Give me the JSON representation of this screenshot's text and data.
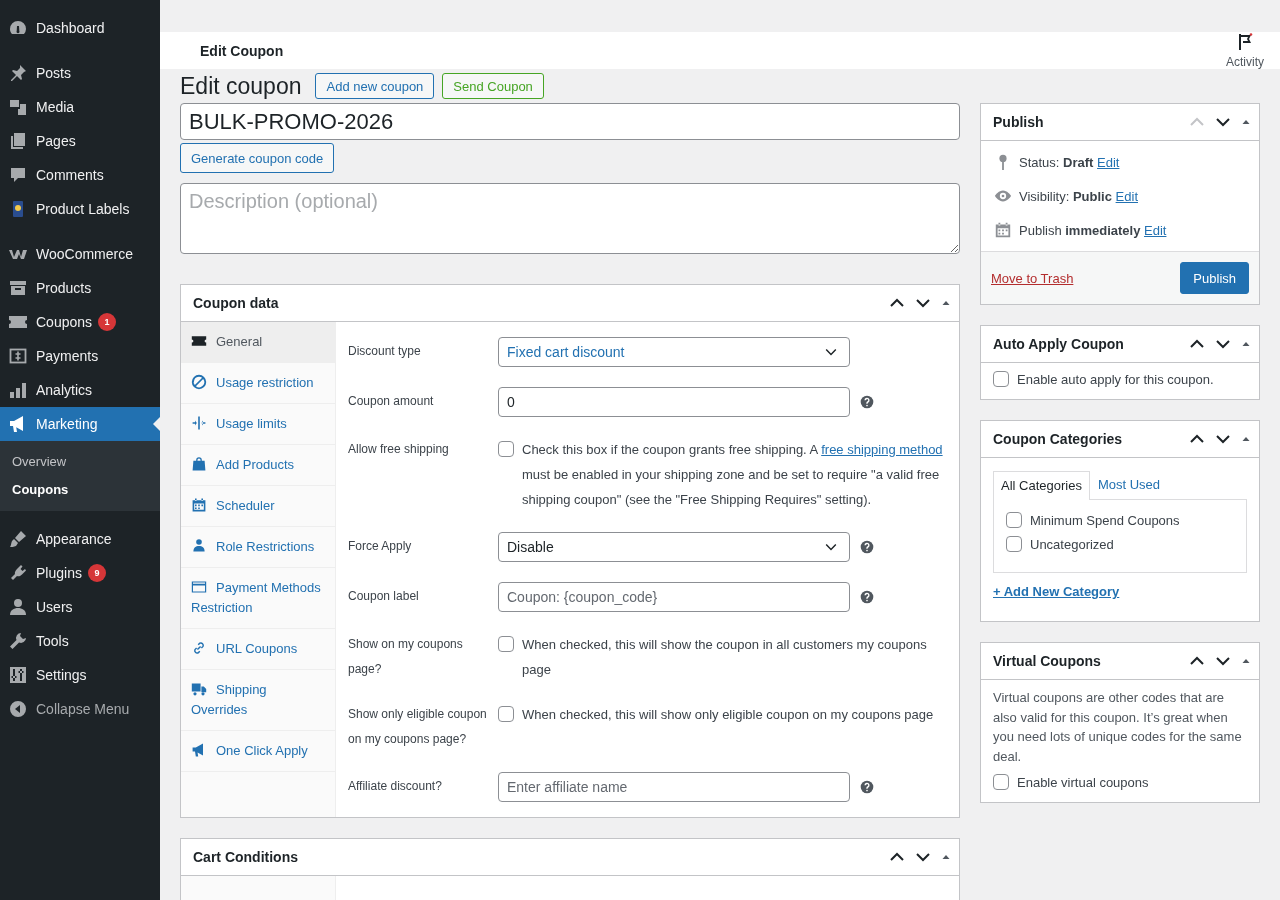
{
  "sidebar": {
    "groups": [
      {
        "items": [
          {
            "label": "Dashboard",
            "selected": false
          }
        ]
      },
      {
        "items": [
          {
            "label": "Posts",
            "selected": false
          },
          {
            "label": "Media",
            "selected": false
          },
          {
            "label": "Pages",
            "selected": false
          },
          {
            "label": "Comments",
            "selected": false
          },
          {
            "label": "Product Labels",
            "selected": false
          }
        ]
      },
      {
        "items": [
          {
            "label": "WooCommerce",
            "selected": false
          },
          {
            "label": "Products",
            "selected": false
          },
          {
            "label": "Coupons",
            "selected": false,
            "badge": "1"
          },
          {
            "label": "Payments",
            "selected": false
          },
          {
            "label": "Analytics",
            "selected": false
          },
          {
            "label": "Marketing",
            "selected": true,
            "submenu": [
              {
                "label": "Overview",
                "selected": false
              },
              {
                "label": "Coupons",
                "selected": true
              }
            ]
          }
        ]
      },
      {
        "items": [
          {
            "label": "Appearance",
            "selected": false
          },
          {
            "label": "Plugins",
            "selected": false,
            "badge": "9"
          },
          {
            "label": "Users",
            "selected": false
          },
          {
            "label": "Tools",
            "selected": false
          },
          {
            "label": "Settings",
            "selected": false
          }
        ]
      }
    ],
    "collapse_label": "Collapse Menu"
  },
  "header": {
    "title": "Edit Coupon",
    "activity_label": "Activity"
  },
  "page": {
    "heading": "Edit coupon",
    "actions": [
      {
        "label": "Add new coupon",
        "kind": "blue"
      },
      {
        "label": "Send Coupon",
        "kind": "green"
      }
    ],
    "coupon_code": "BULK-PROMO-2026",
    "generate_label": "Generate coupon code",
    "description_placeholder": "Description (optional)"
  },
  "main_boxes": [
    {
      "kind": "coupon_data",
      "title": "Coupon data",
      "up_disabled": false,
      "tabs": [
        {
          "label": "General",
          "selected": true
        },
        {
          "label": "Usage restriction",
          "selected": false
        },
        {
          "label": "Usage limits",
          "selected": false
        },
        {
          "label": "Add Products",
          "selected": false
        },
        {
          "label": "Scheduler",
          "selected": false
        },
        {
          "label": "Role Restrictions",
          "selected": false
        },
        {
          "label": "Payment Methods Restriction",
          "selected": false
        },
        {
          "label": "URL Coupons",
          "selected": false
        },
        {
          "label": "Shipping Overrides",
          "selected": false
        },
        {
          "label": "One Click Apply",
          "selected": false
        }
      ],
      "fields": [
        {
          "kind": "select",
          "label": "Discount type",
          "value": "Fixed cart discount",
          "highlighted": true,
          "help": false
        },
        {
          "kind": "input",
          "label": "Coupon amount",
          "value": "0",
          "help": true
        },
        {
          "kind": "checkbox",
          "label": "Allow free shipping",
          "checked": false,
          "parts": [
            {
              "kind": "text",
              "text": "Check this box if the coupon grants free shipping. A "
            },
            {
              "kind": "link",
              "text": "free shipping method"
            },
            {
              "kind": "text",
              "text": " must be enabled in your shipping zone and be set to require \"a valid free shipping coupon\" (see the \"Free Shipping Requires\" setting)."
            }
          ]
        },
        {
          "kind": "select",
          "label": "Force Apply",
          "value": "Disable",
          "highlighted": false,
          "help": true
        },
        {
          "kind": "input",
          "label": "Coupon label",
          "placeholder": "Coupon: {coupon_code}",
          "help": true
        },
        {
          "kind": "checkbox",
          "label": "Show on my coupons page?",
          "checked": false,
          "parts": [
            {
              "kind": "text",
              "text": "When checked, this will show the coupon in all customers my coupons page"
            }
          ]
        },
        {
          "kind": "checkbox",
          "label": "Show only eligible coupon on my coupons page?",
          "checked": false,
          "parts": [
            {
              "kind": "text",
              "text": "When checked, this will show only eligible coupon on my coupons page"
            }
          ]
        },
        {
          "kind": "input",
          "label": "Affiliate discount?",
          "placeholder": "Enter affiliate name",
          "help": true
        }
      ]
    },
    {
      "kind": "cart_conditions",
      "title": "Cart Conditions",
      "up_disabled": false
    }
  ],
  "side_boxes": [
    {
      "kind": "publish",
      "title": "Publish",
      "up_disabled": true,
      "rows": [
        {
          "text": "Status: **Draft**",
          "link": "Edit"
        },
        {
          "text": "Visibility: **Public**",
          "link": "Edit"
        },
        {
          "text": "Publish **immediately**",
          "link": "Edit"
        }
      ],
      "trash_label": "Move to Trash",
      "button_label": "Publish"
    },
    {
      "kind": "checkbox",
      "title": "Auto Apply Coupon",
      "up_disabled": false,
      "checkbox": {
        "label": "Enable auto apply for this coupon.",
        "checked": false
      }
    },
    {
      "kind": "categories",
      "title": "Coupon Categories",
      "up_disabled": false,
      "tabs": [
        {
          "label": "All Categories",
          "selected": true
        },
        {
          "label": "Most Used",
          "selected": false
        }
      ],
      "categories": [
        {
          "label": "Minimum Spend Coupons",
          "checked": false
        },
        {
          "label": "Uncategorized",
          "checked": false
        }
      ],
      "add_link": "+ Add New Category"
    },
    {
      "kind": "virtual",
      "title": "Virtual Coupons",
      "up_disabled": false,
      "description": "Virtual coupons are other codes that are also valid for this coupon. It’s great when you need lots of unique codes for the same deal.",
      "checkbox": {
        "label": "Enable virtual coupons",
        "checked": false
      }
    }
  ]
}
